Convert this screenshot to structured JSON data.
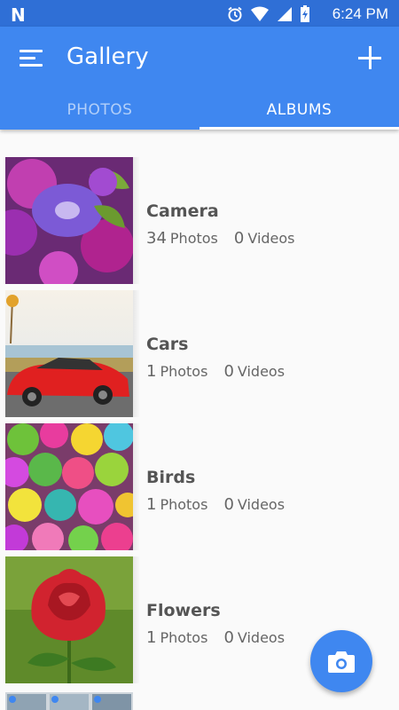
{
  "status_bar": {
    "time": "6:24 PM",
    "logo": "N"
  },
  "app_bar": {
    "title": "Gallery",
    "menu_icon": "menu-icon",
    "add_icon": "plus-icon"
  },
  "tabs": [
    {
      "label": "PHOTOS",
      "active": false
    },
    {
      "label": "ALBUMS",
      "active": true
    }
  ],
  "albums": [
    {
      "name": "Camera",
      "photos_count": "34",
      "photos_label": "Photos",
      "videos_count": "0",
      "videos_label": "Videos",
      "thumbnail": "purple-petunia-flowers"
    },
    {
      "name": "Cars",
      "photos_count": "1",
      "photos_label": "Photos",
      "videos_count": "0",
      "videos_label": "Videos",
      "thumbnail": "red-sports-car"
    },
    {
      "name": "Birds",
      "photos_count": "1",
      "photos_label": "Photos",
      "videos_count": "0",
      "videos_label": "Videos",
      "thumbnail": "colorful-chicks"
    },
    {
      "name": "Flowers",
      "photos_count": "1",
      "photos_label": "Photos",
      "videos_count": "0",
      "videos_label": "Videos",
      "thumbnail": "red-rose"
    }
  ],
  "fab": {
    "icon": "camera-icon"
  },
  "colors": {
    "status_bar": "#2f6fd6",
    "app_bar": "#3f87f0",
    "accent": "#3f87f0"
  }
}
